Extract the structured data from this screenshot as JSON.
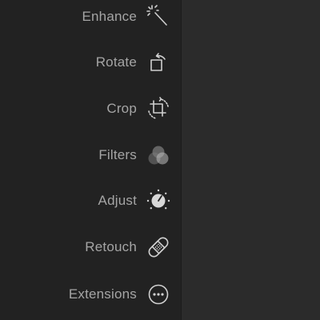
{
  "tools": [
    {
      "label": "Enhance",
      "icon": "magic-wand-icon"
    },
    {
      "label": "Rotate",
      "icon": "rotate-icon"
    },
    {
      "label": "Crop",
      "icon": "crop-icon"
    },
    {
      "label": "Filters",
      "icon": "filters-icon"
    },
    {
      "label": "Adjust",
      "icon": "adjust-dial-icon"
    },
    {
      "label": "Retouch",
      "icon": "bandage-icon"
    },
    {
      "label": "Extensions",
      "icon": "more-icon"
    }
  ],
  "colors": {
    "toolbar_bg": "#222222",
    "canvas_bg": "#2b2b2b",
    "label_text": "#a5a5a5",
    "icon_stroke": "#d0d0d0"
  }
}
